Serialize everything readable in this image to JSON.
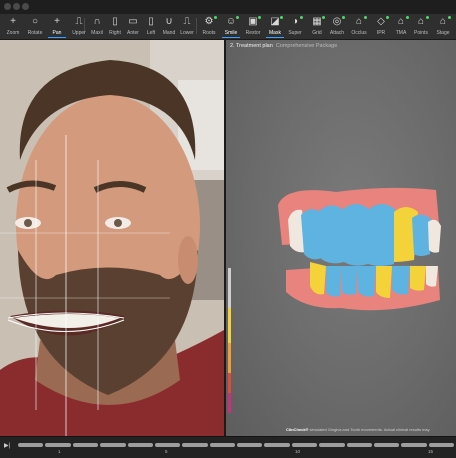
{
  "toolbar": {
    "tools": [
      {
        "icon": "+",
        "label": "Zoom"
      },
      {
        "icon": "○",
        "label": "Rotate"
      },
      {
        "icon": "+",
        "label": "Pan"
      },
      {
        "icon": "⎍",
        "label": "Upper"
      },
      {
        "icon": "∩",
        "label": "Maxil"
      },
      {
        "icon": "▯",
        "label": "Right"
      },
      {
        "icon": "▭",
        "label": "Anter"
      },
      {
        "icon": "▯",
        "label": "Left"
      },
      {
        "icon": "∪",
        "label": "Mand"
      },
      {
        "icon": "⎍",
        "label": "Lower"
      },
      {
        "icon": "⚙",
        "label": "Roots"
      },
      {
        "icon": "☺",
        "label": "Smile"
      },
      {
        "icon": "▣",
        "label": "Restor"
      },
      {
        "icon": "◪",
        "label": "Mask"
      },
      {
        "icon": "◑",
        "label": "Super"
      },
      {
        "icon": "▦",
        "label": "Grid"
      },
      {
        "icon": "◎",
        "label": "Attach"
      },
      {
        "icon": "⌂",
        "label": "Occlus"
      },
      {
        "icon": "◇",
        "label": "IPR"
      },
      {
        "icon": "⌂",
        "label": "TMA"
      },
      {
        "icon": "⌂",
        "label": "Points"
      },
      {
        "icon": "⌂",
        "label": "Stage"
      }
    ],
    "active_tools": [
      "Pan",
      "Smile",
      "Mask"
    ]
  },
  "view": {
    "title": "2. Treatment plan",
    "subtitle": "Comprehensive Package",
    "footnote_brand": "ClinCheck®",
    "footnote_text": "simulated Gingiva and Tooth movements. Actual clinical results may"
  },
  "timeline": {
    "ticks": [
      "1",
      "5",
      "10",
      "15"
    ]
  },
  "colors": {
    "tooth_blue": "#5fb3e0",
    "tooth_yellow": "#f3d23a",
    "gingiva": "#e8837d",
    "accent": "#3aa0ff",
    "scale": [
      "#f3d23a",
      "#f0a030",
      "#e04a3a",
      "#c8307a"
    ]
  }
}
